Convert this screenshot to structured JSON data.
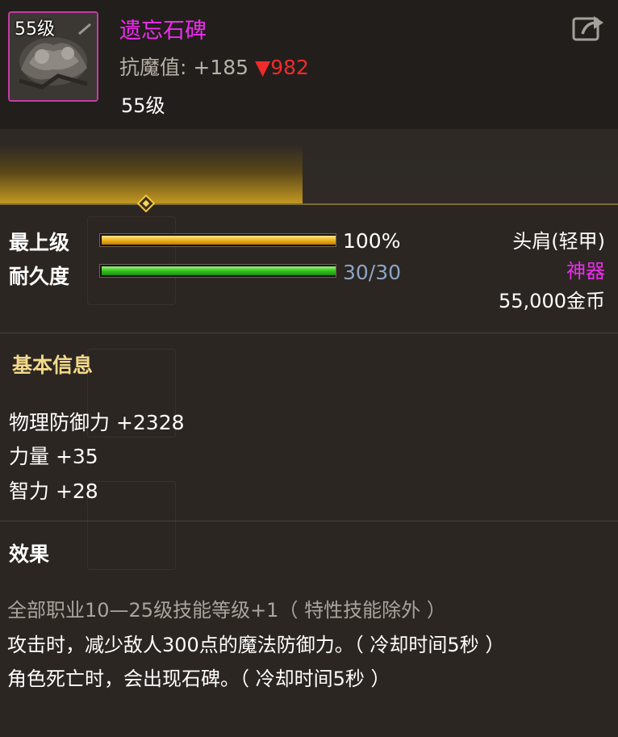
{
  "item": {
    "level_badge": "55级",
    "name": "遗忘石碑",
    "magic_resist_label": "抗魔值:",
    "magic_resist_value": "+185",
    "magic_resist_change": "▼982",
    "level_text": "55级"
  },
  "upgrade": {
    "progress": 0.49
  },
  "stats": {
    "upgrade_label": "最上级",
    "upgrade_percent": "100%",
    "upgrade_fill": 1.0,
    "durability_label": "耐久度",
    "durability_value": "30/30",
    "durability_fill": 1.0
  },
  "meta": {
    "slot": "头肩(轻甲)",
    "rarity": "神器",
    "price": "55,000金币"
  },
  "basic": {
    "title": "基本信息",
    "lines": [
      "物理防御力 +2328",
      "力量 +35",
      "智力 +28"
    ]
  },
  "effects": {
    "title": "效果",
    "lines": [
      "全部职业10—25级技能等级+1（ 特性技能除外 ）",
      "攻击时，减少敌人300点的魔法防御力。（ 冷却时间5秒 ）",
      "角色死亡时，会出现石碑。（ 冷却时间5秒 ）"
    ]
  },
  "colors": {
    "rarity": "#ee2cee",
    "decrease": "#ee2b2b",
    "section_title": "#f3d98a",
    "durability_text": "#8aa6c6"
  }
}
